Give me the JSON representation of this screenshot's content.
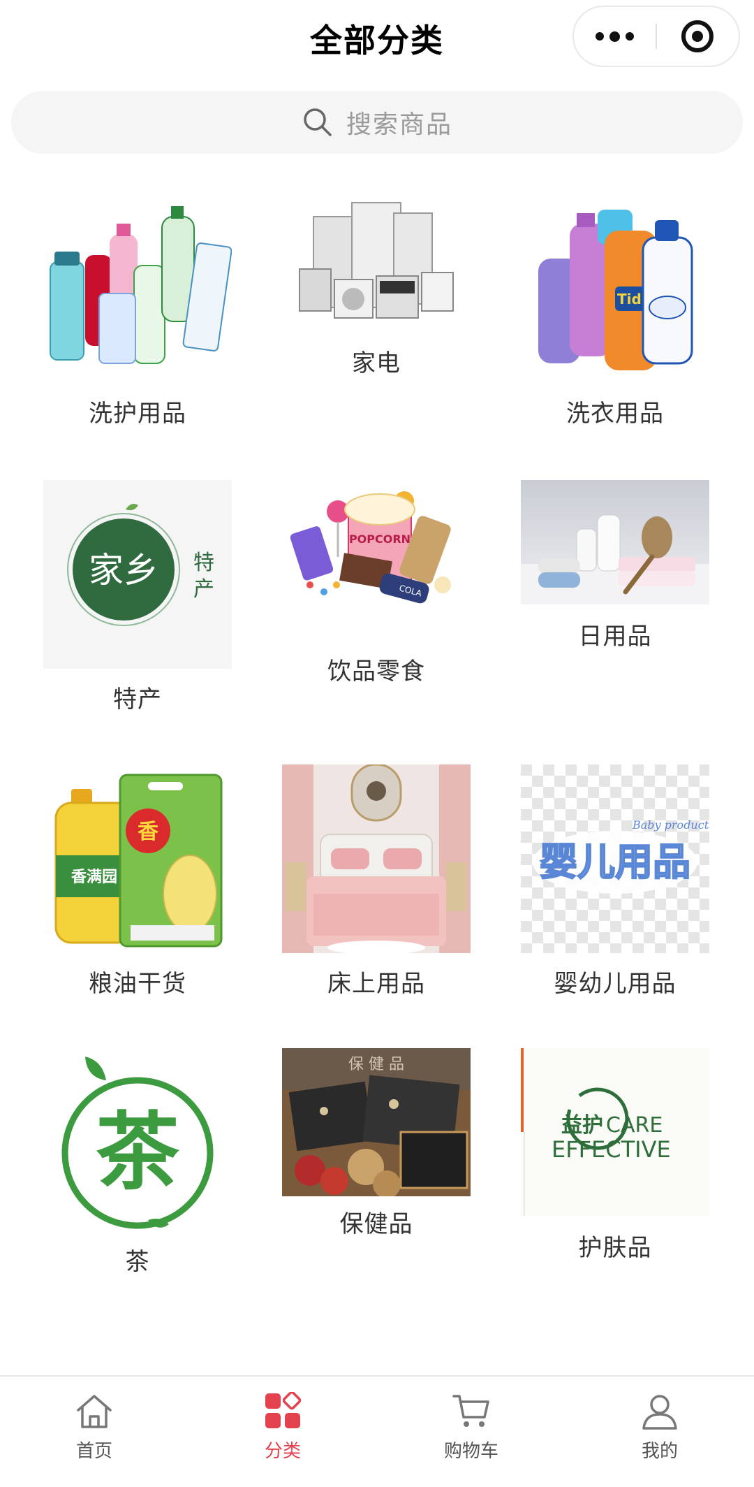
{
  "header": {
    "title": "全部分类"
  },
  "search": {
    "placeholder": "搜索商品"
  },
  "categories": [
    {
      "label": "洗护用品"
    },
    {
      "label": "家电"
    },
    {
      "label": "洗衣用品"
    },
    {
      "label": "特产",
      "image_text_main": "家乡",
      "image_text_side": "特产"
    },
    {
      "label": "饮品零食",
      "image_text": "POPCORN"
    },
    {
      "label": "日用品"
    },
    {
      "label": "粮油干货",
      "image_text": "香满园"
    },
    {
      "label": "床上用品"
    },
    {
      "label": "婴幼儿用品",
      "image_text": "婴儿用品"
    },
    {
      "label": "茶",
      "image_text": "茶"
    },
    {
      "label": "保健品",
      "image_text": "保健品"
    },
    {
      "label": "护肤品",
      "image_text_cn": "益护",
      "image_text_en1": "CARE",
      "image_text_en2": "EFFECTIVE"
    }
  ],
  "tabbar": {
    "items": [
      {
        "label": "首页",
        "icon": "home-icon"
      },
      {
        "label": "分类",
        "icon": "category-icon",
        "active": true
      },
      {
        "label": "购物车",
        "icon": "cart-icon"
      },
      {
        "label": "我的",
        "icon": "user-icon"
      }
    ],
    "active_color": "#e4414f",
    "inactive_color": "#555555"
  }
}
